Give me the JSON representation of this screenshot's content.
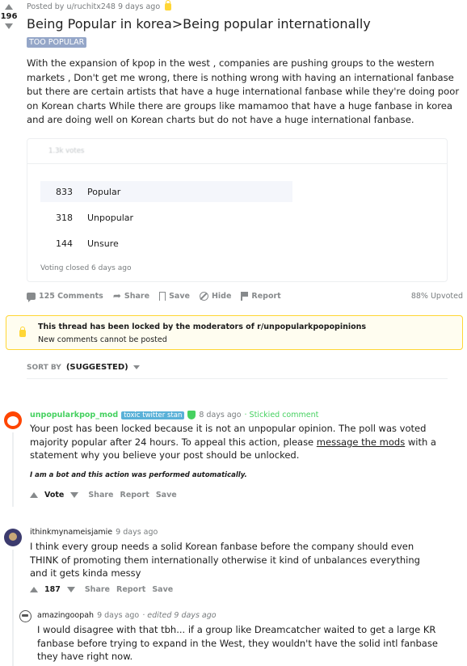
{
  "post": {
    "score": "196",
    "posted_by": "Posted by u/ruchitx248 9 days ago",
    "title": "Being Popular in korea>Being popular internationally",
    "flair": "TOO POPULAR",
    "body": "With the expansion of kpop in the west , companies are pushing groups to the western markets , Don't get me wrong, there is nothing wrong with having an international fanbase but there are certain artists that have a huge international fanbase while they're doing poor on Korean charts While there are groups like mamamoo that have a huge fanbase in korea and are doing well on Korean charts but do not have a huge international fanbase."
  },
  "poll": {
    "total": "1.3k votes",
    "options": [
      {
        "count": "833",
        "label": "Popular"
      },
      {
        "count": "318",
        "label": "Unpopular"
      },
      {
        "count": "144",
        "label": "Unsure"
      }
    ],
    "status": "Voting closed 6 days ago"
  },
  "actions": {
    "comments": "125 Comments",
    "share": "Share",
    "save": "Save",
    "hide": "Hide",
    "report": "Report",
    "upvoted": "88% Upvoted"
  },
  "locked": {
    "title": "This thread has been locked by the moderators of r/unpopularkpopopinions",
    "subtitle": "New comments cannot be posted"
  },
  "sort": {
    "label": "SORT BY",
    "value": "(SUGGESTED)"
  },
  "comments": [
    {
      "author": "unpopularkpop_mod",
      "flair": "toxic twitter stan",
      "time": "8 days ago",
      "stickied": "· Stickied comment",
      "body_before": "Your post has been locked because it is not an unpopular opinion. The poll was voted majority popular after 24 hours. To appeal this action, please ",
      "body_link": "message the mods",
      "body_after": " with a statement why you believe your post should be unlocked.",
      "bot_note": "I am a bot and this action was performed automatically.",
      "vote": "Vote",
      "share": "Share",
      "report": "Report",
      "save": "Save"
    },
    {
      "author": "ithinkmynameisjamie",
      "time": "9 days ago",
      "body": "I think every group needs a solid Korean fanbase before the company should even THINK of promoting them internationally otherwise it kind of unbalances everything and it gets kinda messy",
      "vote": "187",
      "share": "Share",
      "report": "Report",
      "save": "Save"
    },
    {
      "author": "amazingoopah",
      "time": "9 days ago",
      "edited": "· edited 9 days ago",
      "body": "I would disagree with that tbh... if a group like Dreamcatcher waited to get a large KR fanbase before trying to expand in the West, they wouldn't have the solid intl fanbase they have right now."
    }
  ],
  "colors": {
    "mod_green": "#46d160",
    "flair_blue": "#94a6c8",
    "lock_yellow": "#ffd635"
  }
}
